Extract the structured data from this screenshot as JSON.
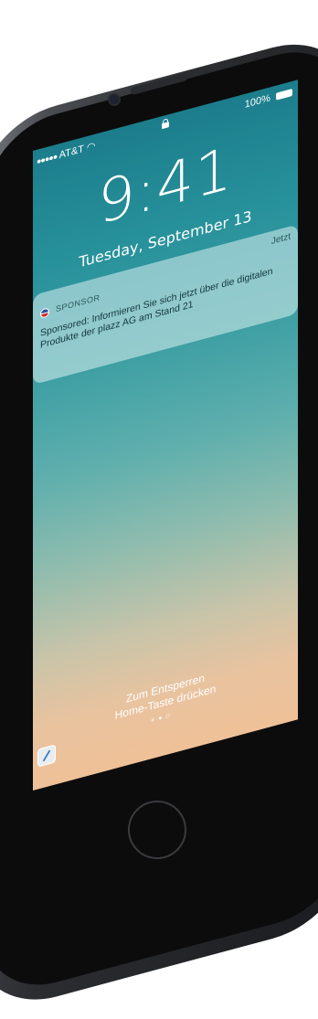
{
  "statusbar": {
    "carrier_dots": "●●●●●",
    "carrier": "AT&T",
    "battery": "100%"
  },
  "lockscreen": {
    "time": "9:41",
    "date": "Tuesday, September 13"
  },
  "notification": {
    "app_name": "SPONSOR",
    "time": "Jetzt",
    "message": "Sponsored: Informieren Sie sich jetzt über die digitalen Produkte der plazz AG am Stand 21"
  },
  "unlock_hint": {
    "line1": "Zum Entsperren",
    "line2": "Home-Taste drücken"
  },
  "colors": {
    "wallpaper_top": "#1c7d8c",
    "wallpaper_bottom": "#efc198",
    "accent_blue": "#1aa0ea"
  },
  "icons": [
    "wifi-icon",
    "lock-icon",
    "battery-icon",
    "app-icon",
    "compass-icon",
    "camera-icon"
  ]
}
